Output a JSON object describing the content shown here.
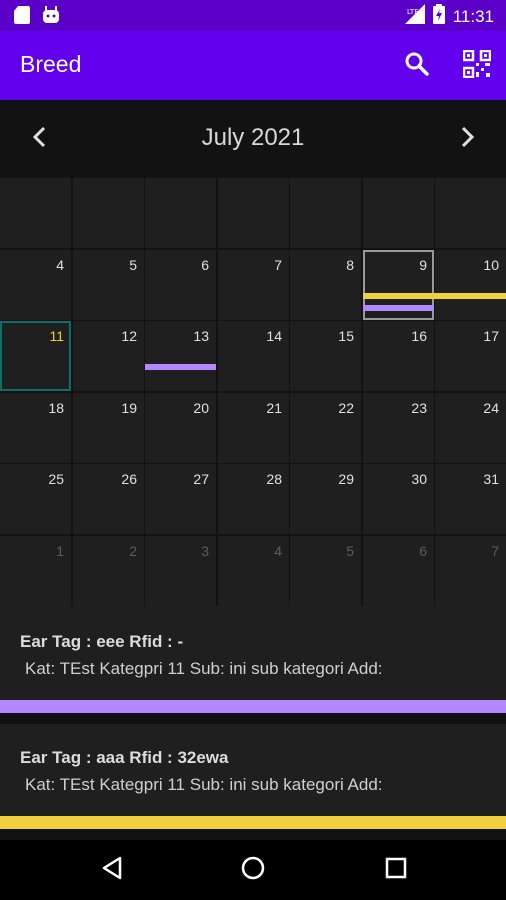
{
  "status_bar": {
    "time": "11:31",
    "left_icons": [
      "sd-card-icon",
      "android-icon"
    ],
    "right_icons": [
      "signal-icon",
      "battery-charging-icon"
    ]
  },
  "app_bar": {
    "title": "Breed",
    "actions": [
      "search-icon",
      "qr-code-icon"
    ],
    "color": "#6200ee"
  },
  "calendar": {
    "month_label": "July 2021",
    "today": "11",
    "selected": "9",
    "rows": [
      [
        {
          "d": "",
          "o": false
        },
        {
          "d": "",
          "o": false
        },
        {
          "d": "",
          "o": false
        },
        {
          "d": "",
          "o": false
        },
        {
          "d": "",
          "o": false
        },
        {
          "d": "",
          "o": false
        },
        {
          "d": "",
          "o": false
        }
      ],
      [
        {
          "d": "4"
        },
        {
          "d": "5"
        },
        {
          "d": "6"
        },
        {
          "d": "7"
        },
        {
          "d": "8"
        },
        {
          "d": "9"
        },
        {
          "d": "10"
        }
      ],
      [
        {
          "d": "11"
        },
        {
          "d": "12"
        },
        {
          "d": "13"
        },
        {
          "d": "14"
        },
        {
          "d": "15"
        },
        {
          "d": "16"
        },
        {
          "d": "17"
        }
      ],
      [
        {
          "d": "18"
        },
        {
          "d": "19"
        },
        {
          "d": "20"
        },
        {
          "d": "21"
        },
        {
          "d": "22"
        },
        {
          "d": "23"
        },
        {
          "d": "24"
        }
      ],
      [
        {
          "d": "25"
        },
        {
          "d": "26"
        },
        {
          "d": "27"
        },
        {
          "d": "28"
        },
        {
          "d": "29"
        },
        {
          "d": "30"
        },
        {
          "d": "31"
        }
      ],
      [
        {
          "d": "1",
          "o": true
        },
        {
          "d": "2",
          "o": true
        },
        {
          "d": "3",
          "o": true
        },
        {
          "d": "4",
          "o": true
        },
        {
          "d": "5",
          "o": true
        },
        {
          "d": "6",
          "o": true
        },
        {
          "d": "7",
          "o": true
        }
      ]
    ],
    "events": [
      {
        "color": "#f2cf3d",
        "days": [
          "9",
          "10"
        ]
      },
      {
        "color": "#b388ff",
        "days": [
          "9"
        ]
      },
      {
        "color": "#b388ff",
        "days": [
          "13"
        ]
      }
    ]
  },
  "entries": [
    {
      "title": "Ear Tag : eee  Rfid : -",
      "subtitle": "Kat: TEst Kategpri 11 Sub: ini sub kategori Add:",
      "color": "#b388ff"
    },
    {
      "title": "Ear Tag : aaa  Rfid : 32ewa",
      "subtitle": "Kat: TEst Kategpri 11 Sub: ini sub kategori Add:",
      "color": "#f2cf3d"
    }
  ],
  "nav_bar": {
    "items": [
      "back-icon",
      "home-icon",
      "recents-icon"
    ]
  }
}
